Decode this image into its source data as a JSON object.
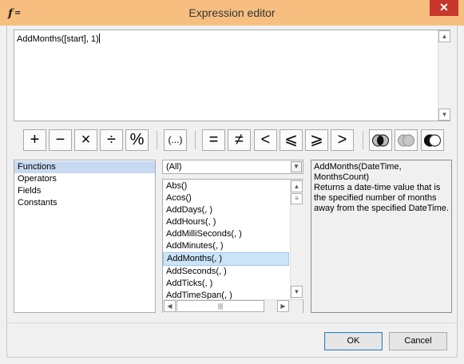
{
  "window": {
    "title": "Expression editor",
    "icon": "function-icon",
    "close_label": "✕"
  },
  "editor": {
    "text": "AddMonths([start], 1"
  },
  "operators": [
    "+",
    "−",
    "×",
    "÷",
    "%",
    "(...)",
    "=",
    "≠",
    "<",
    "⩽",
    "⩾",
    ">"
  ],
  "categories": {
    "items": [
      "Functions",
      "Operators",
      "Fields",
      "Constants"
    ],
    "selected": "Functions"
  },
  "filter": {
    "value": "(All)"
  },
  "functions": {
    "items": [
      "Abs()",
      "Acos()",
      "AddDays(, )",
      "AddHours(, )",
      "AddMilliSeconds(, )",
      "AddMinutes(, )",
      "AddMonths(, )",
      "AddSeconds(, )",
      "AddTicks(, )",
      "AddTimeSpan(, )"
    ],
    "selected": "AddMonths(, )"
  },
  "description": {
    "signature": "AddMonths(DateTime, MonthsCount)",
    "text": "Returns a date-time value that is the specified number of months away from the specified DateTime."
  },
  "buttons": {
    "ok": "OK",
    "cancel": "Cancel"
  },
  "colors": {
    "titlebar": "#f6bf80",
    "close": "#c7372c",
    "selection": "#cce4f7"
  }
}
